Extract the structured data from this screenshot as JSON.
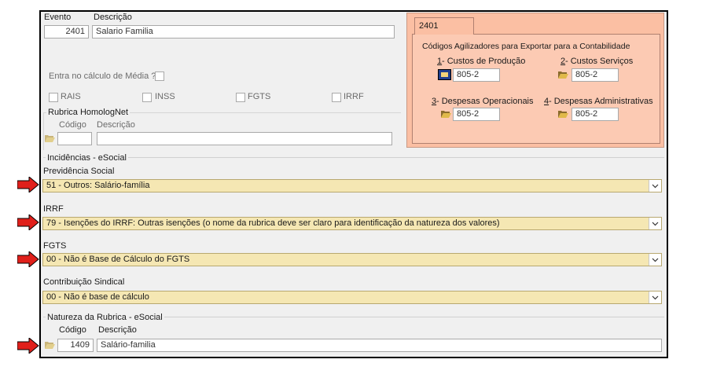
{
  "header": {
    "evento_label": "Evento",
    "descricao_label": "Descrição",
    "evento_value": "2401",
    "descricao_value": "Salario Familia"
  },
  "media": {
    "label": "Entra no cálculo de Média ?"
  },
  "checks": {
    "rais": "RAIS",
    "inss": "INSS",
    "fgts": "FGTS",
    "irrf": "IRRF"
  },
  "homolog": {
    "title": "Rubrica HomologNet",
    "codigo_label": "Código",
    "descricao_label": "Descrição",
    "codigo_value": "",
    "descricao_value": ""
  },
  "contab": {
    "tab_label": "2401",
    "title": "Códigos Agilizadores para Exportar para a Contabilidade",
    "custos_producao_num": "1",
    "custos_producao_label": "- Custos de Produção",
    "custos_producao_value": "805-2",
    "custos_servicos_num": "2",
    "custos_servicos_label": "- Custos Serviços",
    "custos_servicos_value": "805-2",
    "desp_oper_num": "3",
    "desp_oper_label": "- Despesas Operacionais",
    "desp_oper_value": "805-2",
    "desp_adm_num": "4",
    "desp_adm_label": "- Despesas Administrativas",
    "desp_adm_value": "805-2"
  },
  "esocial": {
    "title": "Incidências - eSocial",
    "previdencia_label": "Previdência Social",
    "previdencia_value": "51 - Outros: Salário-família",
    "irrf_label": "IRRF",
    "irrf_value": "79 - Isenções do IRRF: Outras isenções (o nome da rubrica deve ser claro para identificação da natureza dos valores)",
    "fgts_label": "FGTS",
    "fgts_value": "00 - Não é Base de Cálculo do FGTS",
    "sindical_label": "Contribuição Sindical",
    "sindical_value": "00 - Não é base de cálculo"
  },
  "natureza": {
    "title": "Natureza da Rubrica - eSocial",
    "codigo_label": "Código",
    "descricao_label": "Descrição",
    "codigo_value": "1409",
    "descricao_value": "Salário-familia"
  },
  "colors": {
    "panel": "#fbbfa3",
    "select_bg": "#f5e7b3",
    "arrow": "#e0201b"
  }
}
